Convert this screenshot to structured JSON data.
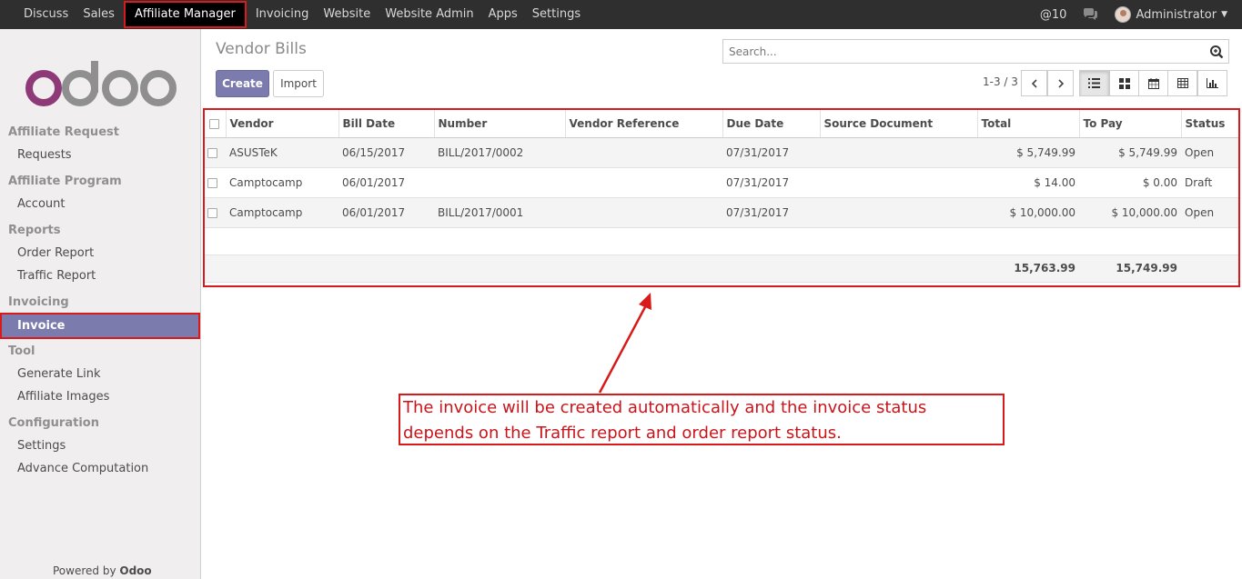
{
  "topbar": {
    "menu": [
      "Discuss",
      "Sales",
      "Affiliate Manager",
      "Invoicing",
      "Website",
      "Website Admin",
      "Apps",
      "Settings"
    ],
    "active": "Affiliate Manager",
    "notifications": "@10",
    "user": "Administrator"
  },
  "sidebar": {
    "sections": [
      {
        "heading": "Affiliate Request",
        "items": [
          "Requests"
        ]
      },
      {
        "heading": "Affiliate Program",
        "items": [
          "Account"
        ]
      },
      {
        "heading": "Reports",
        "items": [
          "Order Report",
          "Traffic Report"
        ]
      },
      {
        "heading": "Invoicing",
        "items": [
          "Invoice"
        ]
      },
      {
        "heading": "Tool",
        "items": [
          "Generate Link",
          "Affiliate Images"
        ]
      },
      {
        "heading": "Configuration",
        "items": [
          "Settings",
          "Advance Computation"
        ]
      }
    ],
    "active_item": "Invoice",
    "powered_prefix": "Powered by",
    "powered_brand": "Odoo"
  },
  "control_panel": {
    "title": "Vendor Bills",
    "create_label": "Create",
    "import_label": "Import",
    "search_placeholder": "Search...",
    "pager": "1-3 / 3"
  },
  "table": {
    "columns": [
      "Vendor",
      "Bill Date",
      "Number",
      "Vendor Reference",
      "Due Date",
      "Source Document",
      "Total",
      "To Pay",
      "Status"
    ],
    "rows": [
      {
        "vendor": "ASUSTeK",
        "bill_date": "06/15/2017",
        "number": "BILL/2017/0002",
        "vendor_reference": "",
        "due_date": "07/31/2017",
        "source_document": "",
        "total": "$ 5,749.99",
        "to_pay": "$ 5,749.99",
        "status": "Open"
      },
      {
        "vendor": "Camptocamp",
        "bill_date": "06/01/2017",
        "number": "",
        "vendor_reference": "",
        "due_date": "07/31/2017",
        "source_document": "",
        "total": "$ 14.00",
        "to_pay": "$ 0.00",
        "status": "Draft"
      },
      {
        "vendor": "Camptocamp",
        "bill_date": "06/01/2017",
        "number": "BILL/2017/0001",
        "vendor_reference": "",
        "due_date": "07/31/2017",
        "source_document": "",
        "total": "$ 10,000.00",
        "to_pay": "$ 10,000.00",
        "status": "Open"
      }
    ],
    "footer": {
      "total": "15,763.99",
      "to_pay": "15,749.99"
    }
  },
  "annotation": {
    "line1": "The invoice will be created automatically and the invoice status",
    "line2": "depends on the Traffic report and order report status."
  },
  "colors": {
    "brand": "#7c7bad",
    "highlight": "#d81a1a",
    "topbar": "#2f2f2f"
  }
}
